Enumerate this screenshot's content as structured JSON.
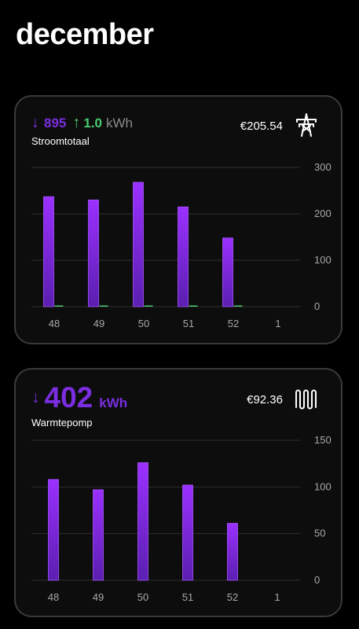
{
  "page": {
    "title": "december"
  },
  "cards": [
    {
      "import_value": "895",
      "export_value": "1.0",
      "unit": "kWh",
      "label": "Stroomtotaal",
      "cost": "€205.54",
      "icon": "power-pylon-icon"
    },
    {
      "import_value": "402",
      "unit": "kWh",
      "label": "Warmtepomp",
      "cost": "€92.36",
      "icon": "heat-pump-radiator-icon"
    }
  ],
  "colors": {
    "import": "#7a2ee0",
    "export": "#4ccb70",
    "grid": "#2e2e2e",
    "card_border": "#3a3a3a"
  },
  "chart_data": [
    {
      "type": "bar",
      "categories": [
        "48",
        "49",
        "50",
        "51",
        "52",
        "1"
      ],
      "series": [
        {
          "values": [
            237,
            230,
            268,
            215,
            148,
            0
          ]
        },
        {
          "values": [
            1,
            1,
            1,
            1,
            1,
            0
          ]
        }
      ],
      "ylim": [
        0,
        300
      ],
      "yticks": [
        "0",
        "100",
        "200",
        "300"
      ],
      "grid": true
    },
    {
      "type": "bar",
      "categories": [
        "48",
        "49",
        "50",
        "51",
        "52",
        "1"
      ],
      "series": [
        {
          "values": [
            108,
            97,
            126,
            102,
            61,
            0
          ]
        }
      ],
      "ylim": [
        0,
        150
      ],
      "yticks": [
        "0",
        "50",
        "100",
        "150"
      ],
      "grid": true
    }
  ]
}
